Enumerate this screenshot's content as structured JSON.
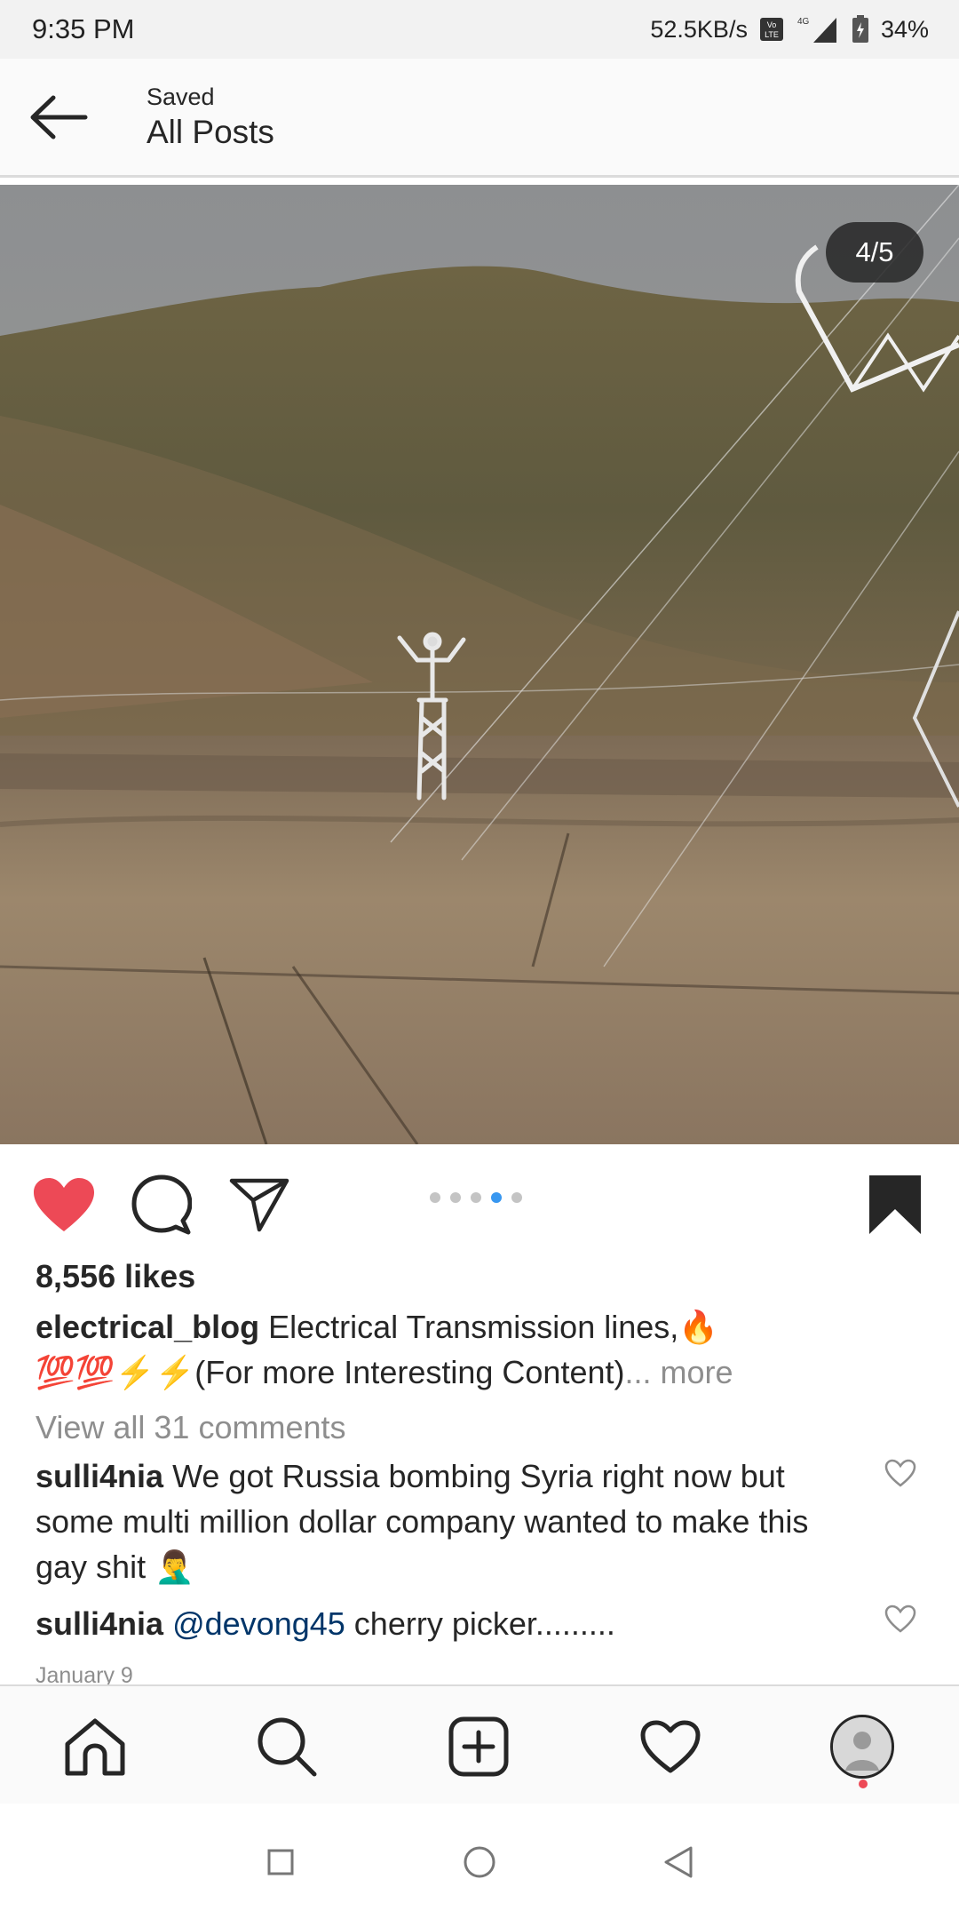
{
  "status_bar": {
    "time": "9:35 PM",
    "speed": "52.5KB/s",
    "network": "4G",
    "battery": "34%"
  },
  "header": {
    "subtitle": "Saved",
    "title": "All Posts"
  },
  "post": {
    "carousel_counter": "4/5",
    "carousel_total": 5,
    "carousel_current": 4,
    "likes": "8,556 likes",
    "caption_username": "electrical_blog",
    "caption_text_line1": "Electrical Transmission lines,",
    "caption_emoji_line1": "🔥",
    "caption_emoji_line2": "💯💯⚡⚡",
    "caption_text_line2": "(For more Interesting Content)",
    "caption_more": "... more",
    "view_comments": "View all 31 comments",
    "comments": [
      {
        "username": "sulli4nia",
        "text": "We got Russia bombing Syria right now but some multi million dollar company wanted to make this gay shit",
        "emoji": "🤦‍♂️"
      },
      {
        "username": "sulli4nia",
        "mention": "@devong45",
        "text": "cherry picker........."
      }
    ],
    "date": "January 9"
  },
  "colors": {
    "like_red": "#ed4956",
    "active_dot": "#3897f0",
    "muted": "#8e8e8e",
    "mention": "#003569"
  },
  "icons": {
    "back": "arrow-left-icon",
    "like": "heart-filled-icon",
    "comment": "comment-bubble-icon",
    "share": "paper-plane-icon",
    "save": "bookmark-filled-icon",
    "home": "home-icon",
    "search": "search-icon",
    "add": "add-post-icon",
    "activity": "heart-outline-icon",
    "profile": "profile-avatar"
  }
}
